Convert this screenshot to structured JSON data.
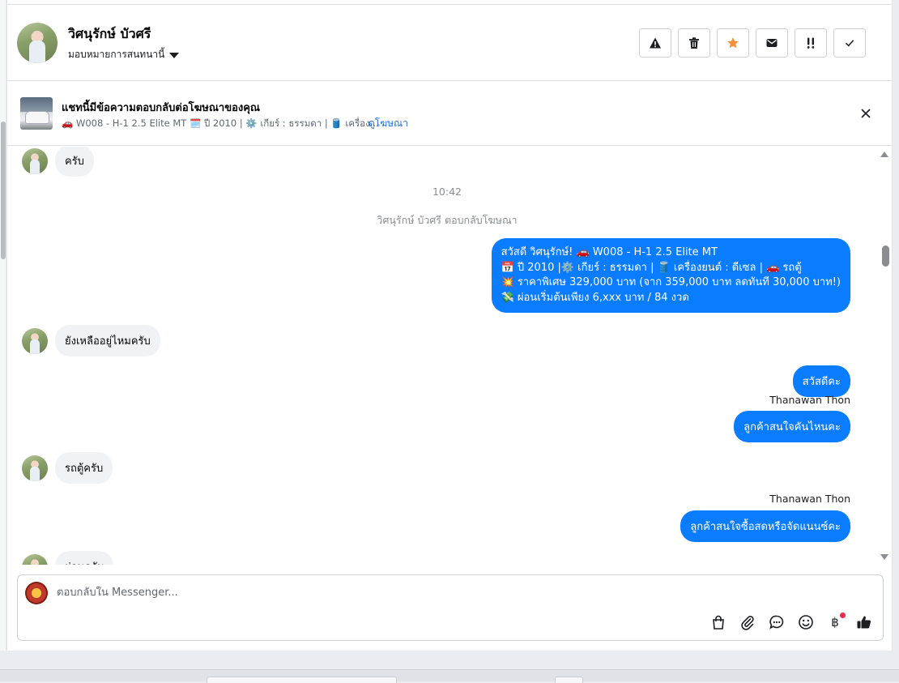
{
  "header": {
    "contact_name": "วิศนุรักษ์ บัวศรี",
    "assign_label": "มอบหมายการสนทนานี้",
    "actions": [
      {
        "icon": "warning-icon",
        "label": "Report"
      },
      {
        "icon": "trash-icon",
        "label": "Delete"
      },
      {
        "icon": "star-icon",
        "label": "Star"
      },
      {
        "icon": "envelope-icon",
        "label": "Mark unread"
      },
      {
        "icon": "follow-up-icon",
        "label": "Follow up"
      },
      {
        "icon": "check-icon",
        "label": "Done"
      }
    ]
  },
  "ad_banner": {
    "title": "แชทนี้มีข้อความตอบกลับต่อโฆษณาของคุณ",
    "detail": "🚗 W008 - H-1 2.5 Elite MT 🗓️ ปี 2010 | ⚙️ เกียร์ : ธรรมดา | 🛢️ เครื่อง...",
    "link_label": "ดูโฆษณา"
  },
  "thread": {
    "messages": [
      {
        "dir": "in",
        "text": "ครับ"
      },
      {
        "type": "time",
        "text": "10:42"
      },
      {
        "type": "system",
        "text": "วิศนุรักษ์ บัวศรี ตอบกลับโฆษณา"
      },
      {
        "dir": "out",
        "lines": [
          "สวัสดี วิศนุรักษ์! 🚗 W008 - H-1 2.5 Elite MT",
          "📅 ปี 2010 |⚙️ เกียร์ : ธรรมดา | 🛢️ เครื่องยนต์ : ดีเซล | 🚗 รถตู้",
          "💥 ราคาพิเศษ 329,000 บาท (จาก 359,000 บาท ลดทันที 30,000 บาท!)",
          "💸 ผ่อนเริ่มต้นเพียง 6,xxx บาท / 84 งวด"
        ]
      },
      {
        "dir": "in",
        "text": "ยังเหลืออยู่ไหมครับ"
      },
      {
        "dir": "out",
        "text": "สวัสดีคะ"
      },
      {
        "type": "sender",
        "text": "Thanawan Thon"
      },
      {
        "dir": "out",
        "text": "ลูกค้าสนใจคันไหนคะ"
      },
      {
        "dir": "in",
        "text": "รถตู้ครับ"
      },
      {
        "type": "sender",
        "text": "Thanawan Thon"
      },
      {
        "dir": "out",
        "text": "ลูกค้าสนใจซื้อสดหรือจัดแนนซ์คะ"
      },
      {
        "dir": "in",
        "text": "ผ่อนครับ"
      }
    ]
  },
  "composer": {
    "placeholder": "ตอบกลับใน Messenger...",
    "tools": [
      "shopping-bag-icon",
      "paperclip-icon",
      "saved-reply-icon",
      "emoji-icon",
      "baht-icon",
      "thumbs-up-icon"
    ],
    "baht_symbol": "฿"
  }
}
